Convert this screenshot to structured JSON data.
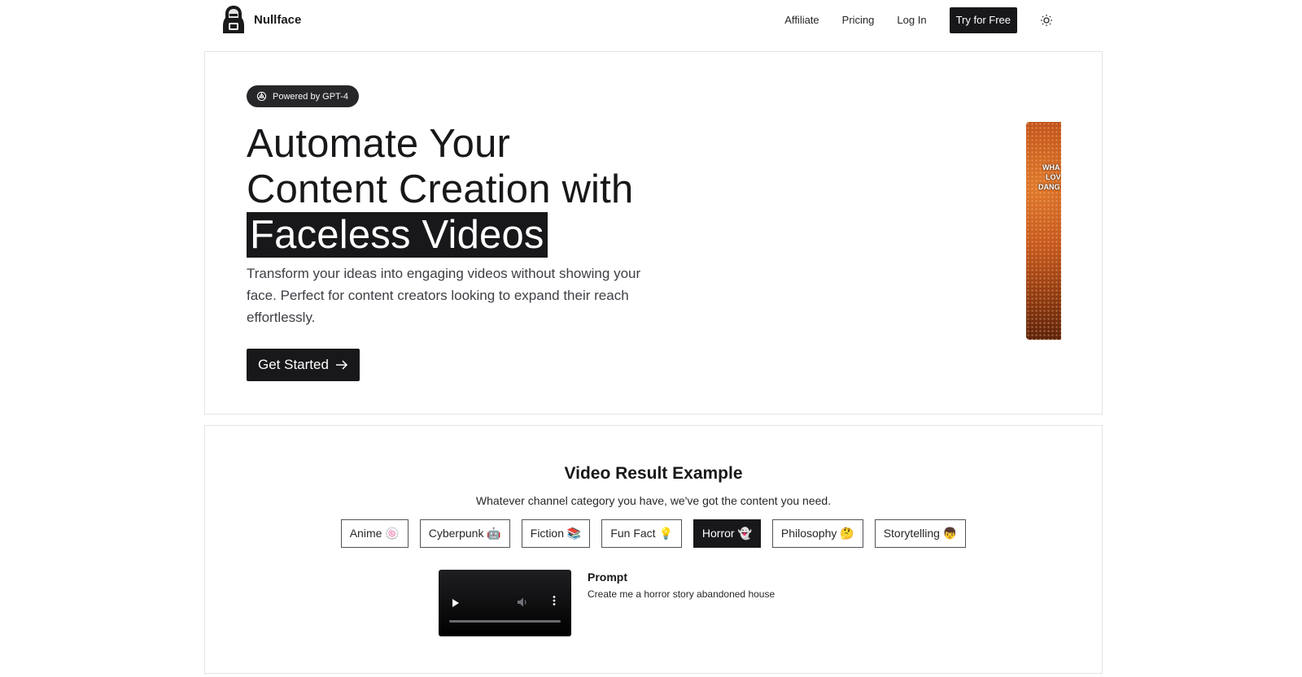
{
  "brand": {
    "name": "Nullface",
    "logo_icon": "hooded-figure-icon"
  },
  "nav": {
    "links": [
      "Affiliate",
      "Pricing",
      "Log In"
    ],
    "cta": "Try for Free",
    "theme_icon": "sun-icon"
  },
  "hero": {
    "badge": "Powered by GPT-4",
    "badge_icon": "openai-logo-icon",
    "headline_line1": "Automate Your",
    "headline_line2": "Content Creation with",
    "headline_highlight": "Faceless Videos",
    "subtext": "Transform your ideas into engaging videos without showing your face. Perfect for content creators looking to expand their reach effortlessly.",
    "button": "Get Started",
    "button_icon": "arrow-right-icon",
    "video_caption": [
      "WHA",
      "LOV",
      "DANG"
    ]
  },
  "example": {
    "title": "Video Result Example",
    "subtitle": "Whatever channel category you have, we've got the content you need.",
    "categories": [
      {
        "label": "Anime 🍥",
        "active": false
      },
      {
        "label": "Cyberpunk 🤖",
        "active": false
      },
      {
        "label": "Fiction 📚",
        "active": false
      },
      {
        "label": "Fun Fact 💡",
        "active": false
      },
      {
        "label": "Horror 👻",
        "active": true
      },
      {
        "label": "Philosophy 🤔",
        "active": false
      },
      {
        "label": "Storytelling 👦",
        "active": false
      }
    ],
    "prompt_label": "Prompt",
    "prompt_text": "Create me a horror story abandoned house",
    "player_icons": [
      "play-icon",
      "volume-icon",
      "more-vertical-icon"
    ]
  },
  "colors": {
    "primary": "#18181b",
    "border": "#e4e4e7",
    "badge_bg": "#27272a"
  }
}
